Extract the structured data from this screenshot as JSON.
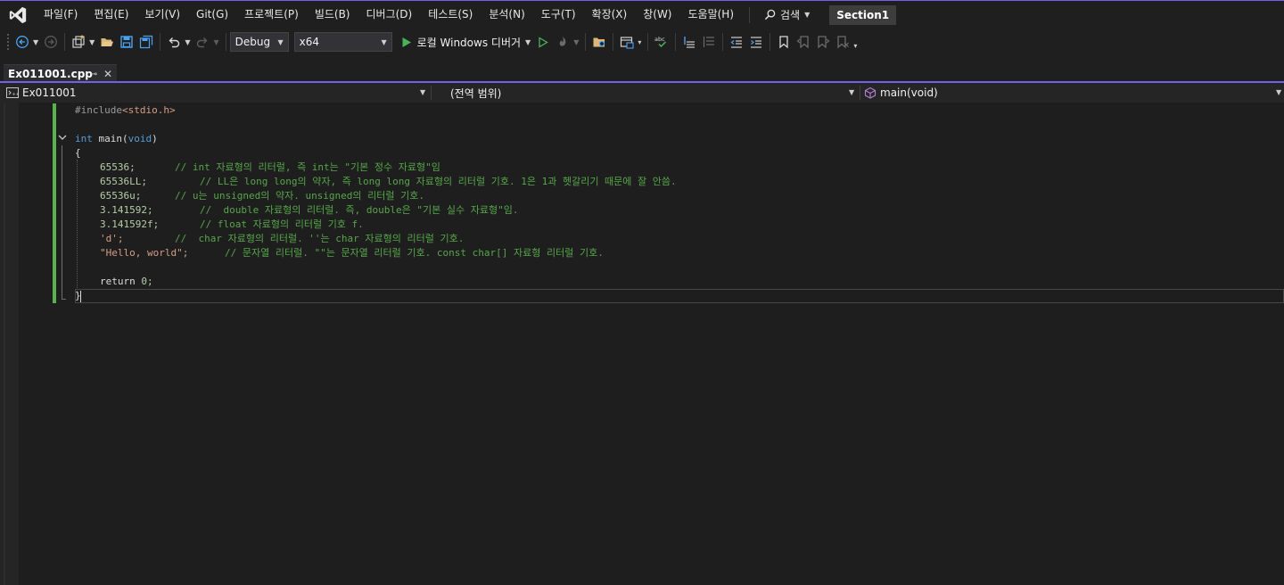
{
  "menu": {
    "items": [
      "파일(F)",
      "편집(E)",
      "보기(V)",
      "Git(G)",
      "프로젝트(P)",
      "빌드(B)",
      "디버그(D)",
      "테스트(S)",
      "분석(N)",
      "도구(T)",
      "확장(X)",
      "창(W)",
      "도움말(H)"
    ],
    "search_label": "검색",
    "solution_name": "Section1"
  },
  "toolbar": {
    "configuration": "Debug",
    "platform": "x64",
    "run_label": "로컬 Windows 디버거"
  },
  "tab": {
    "title": "Ex011001.cpp"
  },
  "navbar": {
    "project": "Ex011001",
    "scope": "(전역 범위)",
    "member": "main(void)"
  },
  "code": {
    "include_directive": "#include",
    "include_header": "<stdio.h>",
    "main_kw": "int",
    "main_name": "main",
    "main_paren_open": "(",
    "main_param": "void",
    "main_paren_close": ")",
    "open_brace": "{",
    "close_brace": "}",
    "lines": [
      {
        "literal": "65536;",
        "comment": "// int 자료형의 리터럴, 즉 int는 \"기본 정수 자료형\"임"
      },
      {
        "literal": "65536LL;",
        "comment": "// LL은 long long의 약자, 즉 long long 자료형의 리터럴 기호. 1은 1과 헷갈리기 때문에 잘 안씀."
      },
      {
        "literal": "65536u;",
        "comment": "// u는 unsigned의 약자. unsigned의 리터럴 기호."
      },
      {
        "literal": "3.141592;",
        "comment": "//  double 자료형의 리터럴. 즉, double은 \"기본 실수 자료형\"임."
      },
      {
        "literal": "3.141592f;",
        "comment": "// float 자료형의 리터럴 기호 f."
      },
      {
        "literal": "'d';",
        "comment": "//  char 자료형의 리터럴. ''는 char 자료형의 리터럴 기호."
      },
      {
        "literal": "\"Hello, world\";",
        "comment": "// 문자열 리터럴. \"\"는 문자열 리터럴 기호. const char[] 자료형 리터럴 기호."
      }
    ],
    "return_kw": "return",
    "return_value": "0;"
  },
  "colors": {
    "accent": "#7160e8",
    "keyword": "#569cd6",
    "comment": "#57a64a",
    "change_bar": "#58b34f"
  }
}
